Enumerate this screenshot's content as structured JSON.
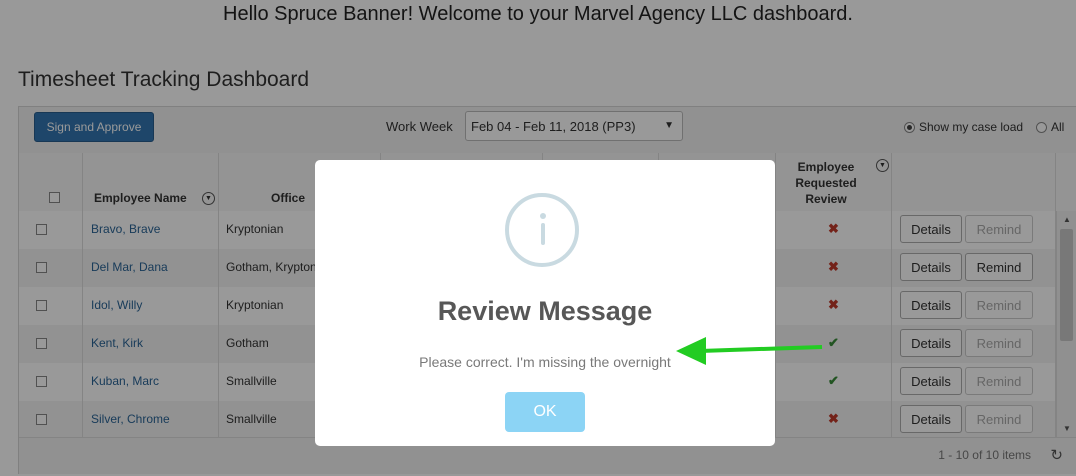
{
  "header": {
    "welcome": "Hello Spruce Banner! Welcome to your Marvel Agency LLC dashboard.",
    "page_title": "Timesheet Tracking Dashboard"
  },
  "toolbar": {
    "sign_approve": "Sign and Approve",
    "work_week_label": "Work Week",
    "work_week_value": "Feb 04 - Feb 11, 2018 (PP3)",
    "radio_caseload": "Show my case load",
    "radio_all": "All"
  },
  "columns": {
    "name": "Employee Name",
    "office": "Office",
    "requested_review_1": "Employee",
    "requested_review_2": "Requested",
    "requested_review_3": "Review"
  },
  "rows": [
    {
      "name": "Bravo, Brave",
      "office": "Kryptonian",
      "review": "x",
      "details": "Details",
      "remind": "Remind",
      "remind_enabled": false
    },
    {
      "name": "Del Mar, Dana",
      "office": "Gotham, Kryptonian",
      "review": "x",
      "details": "Details",
      "remind": "Remind",
      "remind_enabled": true
    },
    {
      "name": "Idol, Willy",
      "office": "Kryptonian",
      "review": "x",
      "details": "Details",
      "remind": "Remind",
      "remind_enabled": false
    },
    {
      "name": "Kent, Kirk",
      "office": "Gotham",
      "review": "check",
      "details": "Details",
      "remind": "Remind",
      "remind_enabled": false
    },
    {
      "name": "Kuban, Marc",
      "office": "Smallville",
      "review": "check",
      "details": "Details",
      "remind": "Remind",
      "remind_enabled": false
    },
    {
      "name": "Silver, Chrome",
      "office": "Smallville",
      "review": "x",
      "details": "Details",
      "remind": "Remind",
      "remind_enabled": false
    }
  ],
  "footer": {
    "pager": "1 - 10 of 10 items"
  },
  "modal": {
    "title": "Review Message",
    "message": "Please correct. I'm missing the overnight",
    "ok": "OK"
  },
  "colors": {
    "primary": "#3276b1",
    "ok_button": "#8cd4f5",
    "annotation_arrow": "#22cc22",
    "x_mark": "#c0392b",
    "check_mark": "#3a8d3a"
  }
}
